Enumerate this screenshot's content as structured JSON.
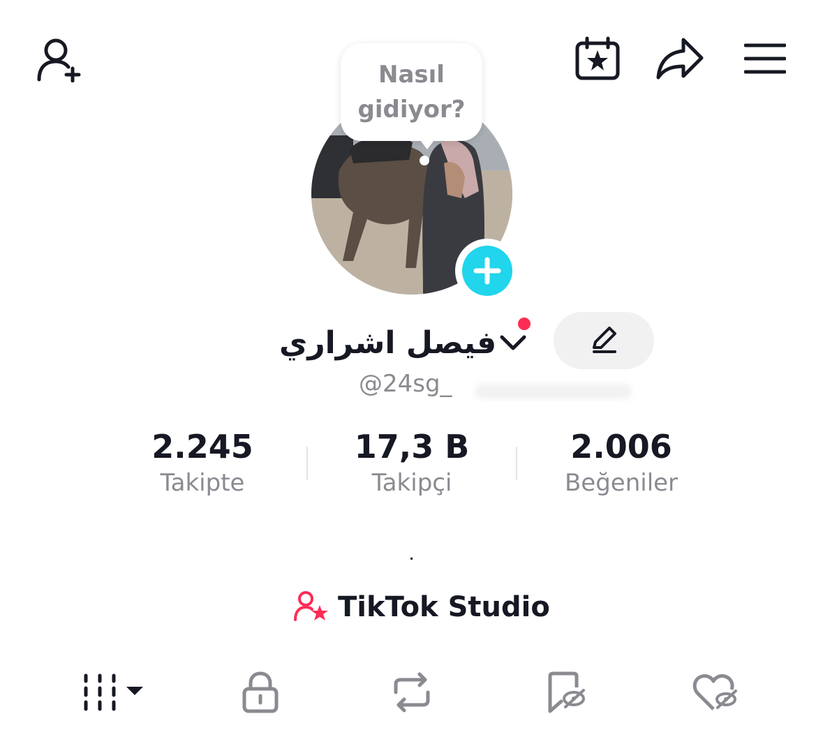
{
  "header": {
    "icons": [
      "add-friend-icon",
      "calendar-star-icon",
      "share-icon",
      "menu-icon"
    ]
  },
  "bubble": {
    "text": "Nasıl\ngidiyor?"
  },
  "profile": {
    "display_name": "فيصل اشراري",
    "handle": "@24sg_"
  },
  "stats": [
    {
      "value": "2.245",
      "label": "Takipte"
    },
    {
      "value": "17,3 B",
      "label": "Takipçi"
    },
    {
      "value": "2.006",
      "label": "Beğeniler"
    }
  ],
  "bio": ".",
  "studio": {
    "label": "TikTok Studio"
  },
  "tabs": [
    "videos-grid-icon",
    "lock-icon",
    "repost-icon",
    "bookmark-hidden-icon",
    "heart-hidden-icon"
  ],
  "colors": {
    "accent_cyan": "#20d5ec",
    "accent_red": "#fe2c55",
    "text_primary": "#161823",
    "text_secondary": "#8a8b91"
  }
}
